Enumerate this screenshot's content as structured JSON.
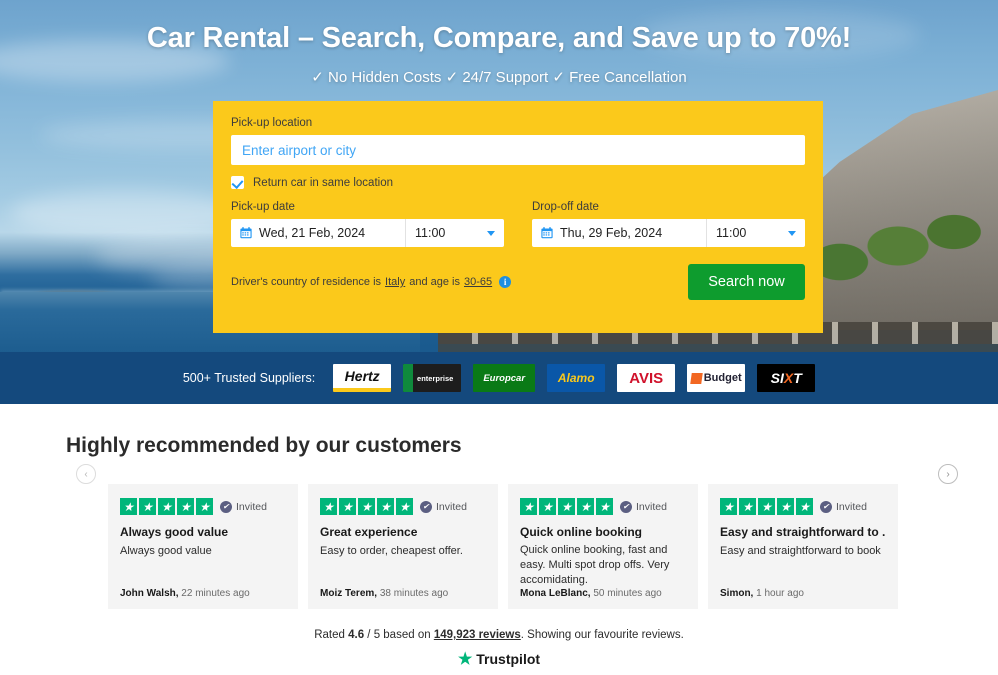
{
  "hero": {
    "title": "Car Rental – Search, Compare, and Save up to 70%!",
    "subtitle": "✓ No Hidden Costs ✓ 24/7 Support ✓ Free Cancellation"
  },
  "search_form": {
    "pickup_location_label": "Pick-up location",
    "pickup_location_value": "",
    "pickup_location_placeholder": "Enter airport or city",
    "same_location_label": "Return car in same location",
    "same_location_checked": true,
    "pickup_date_label": "Pick-up date",
    "pickup_date_value": "Wed, 21 Feb, 2024",
    "pickup_time_value": "11:00",
    "dropoff_date_label": "Drop-off date",
    "dropoff_date_value": "Thu, 29 Feb, 2024",
    "dropoff_time_value": "11:00",
    "driver_note_prefix": "Driver's country of residence is",
    "driver_country": "Italy",
    "driver_note_middle": "and age is",
    "driver_age": "30-65",
    "info_glyph": "i",
    "search_button": "Search now",
    "accent_color": "#fbc91b",
    "button_color": "#0e9c2e"
  },
  "suppliers": {
    "label": "500+ Trusted Suppliers:",
    "bar_color": "#14497d",
    "logos": [
      {
        "name": "Hertz",
        "text": "Hertz"
      },
      {
        "name": "Enterprise",
        "text": "enterprise"
      },
      {
        "name": "Europcar",
        "text": "Europcar"
      },
      {
        "name": "Alamo",
        "text": "Alamo"
      },
      {
        "name": "Avis",
        "text": "AVIS"
      },
      {
        "name": "Budget",
        "text": "Budget"
      },
      {
        "name": "Sixt",
        "text": "SI",
        "text2": "X",
        "text3": "T"
      }
    ]
  },
  "reviews": {
    "heading": "Highly recommended by our customers",
    "invited_label": "Invited",
    "star_glyph": "★",
    "verified_glyph": "✔",
    "prev_glyph": "‹",
    "next_glyph": "›",
    "items": [
      {
        "stars": 5,
        "title": "Always good value",
        "body": "Always good value",
        "author": "John Walsh,",
        "time": " 22 minutes ago"
      },
      {
        "stars": 5,
        "title": "Great experience",
        "body": "Easy to order, cheapest offer.",
        "author": "Moiz Terem,",
        "time": " 38 minutes ago"
      },
      {
        "stars": 5,
        "title": "Quick online booking",
        "body": "Quick online booking, fast and easy. Multi spot drop offs. Very accomidating.",
        "author": "Mona LeBlanc,",
        "time": " 50 minutes ago"
      },
      {
        "stars": 5,
        "title": "Easy and straightforward to ...",
        "body": "Easy and straightforward to book",
        "author": "Simon,",
        "time": " 1 hour ago"
      }
    ],
    "rating_prefix": "Rated ",
    "rating_score": "4.6",
    "rating_middle": " / 5 based on ",
    "rating_count": "149,923 reviews",
    "rating_suffix": ". Showing our favourite reviews.",
    "trustpilot_name": "Trustpilot",
    "trustpilot_star": "★",
    "trustpilot_color": "#00b67a"
  }
}
